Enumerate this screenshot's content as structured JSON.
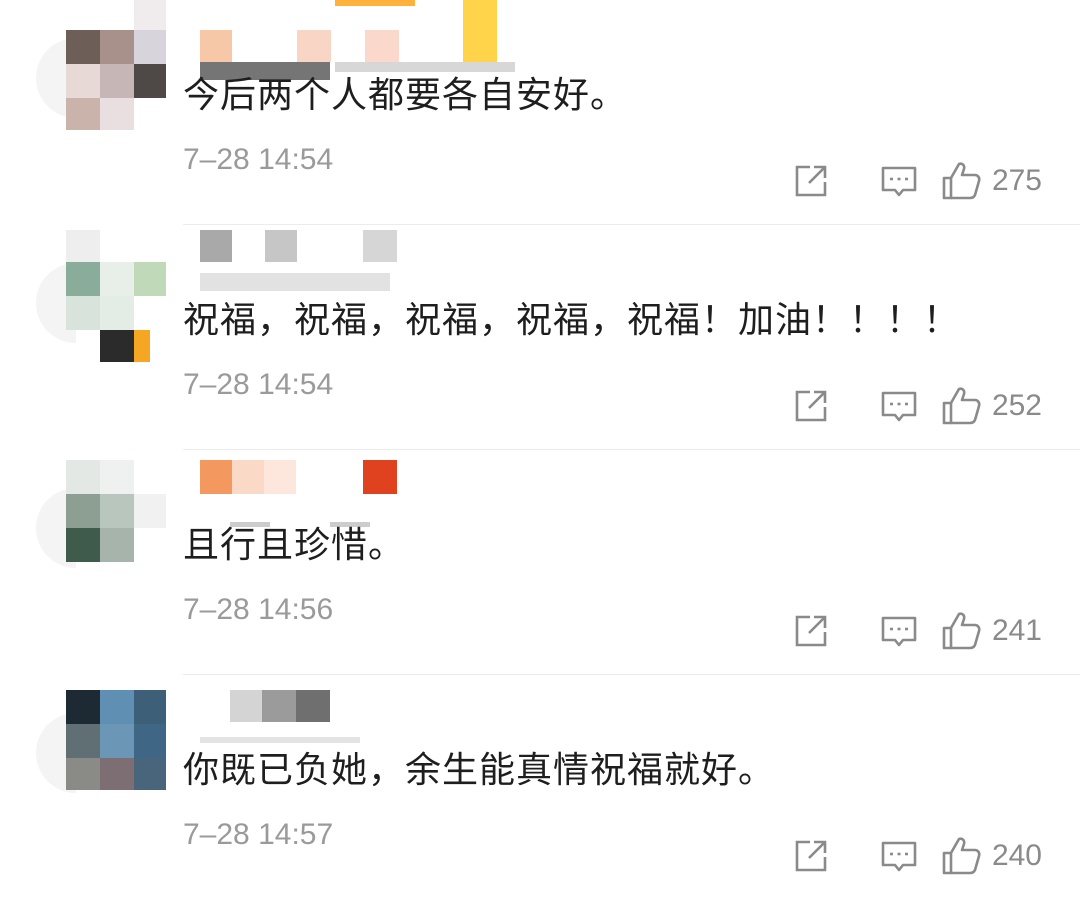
{
  "comments": [
    {
      "text": "今后两个人都要各自安好。",
      "time": "7–28 14:54",
      "likes": "275",
      "name_blurred": true,
      "avatar_blurred": true
    },
    {
      "text": "祝福，祝福，祝福，祝福，祝福！加油！！！！",
      "time": "7–28 14:54",
      "likes": "252",
      "name_blurred": true,
      "avatar_blurred": true
    },
    {
      "text": "且行且珍惜。",
      "time": "7–28 14:56",
      "likes": "241",
      "name_blurred": true,
      "avatar_blurred": true
    },
    {
      "text": "你既已负她，余生能真情祝福就好。",
      "time": "7–28 14:57",
      "likes": "240",
      "name_blurred": true,
      "avatar_blurred": true
    }
  ],
  "icons": {
    "share": "share-icon",
    "reply": "comment-icon",
    "like": "thumbs-up-icon"
  },
  "colors": {
    "text": "#1e1e1e",
    "meta": "#9a9a9a",
    "icon": "#8a8a8a",
    "divider": "#ececec"
  }
}
